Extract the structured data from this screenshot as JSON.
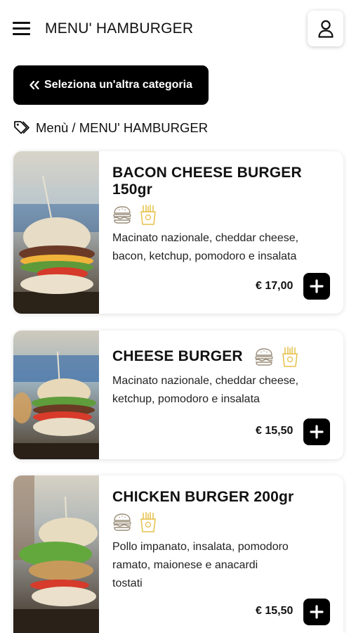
{
  "header": {
    "title": "MENU' HAMBURGER",
    "menu_icon": "hamburger-menu-icon",
    "user_icon": "user-icon"
  },
  "category_button": {
    "icon": "double-chevron-left-icon",
    "label": "Seleziona un'altra categoria"
  },
  "breadcrumb": {
    "icon": "tags-icon",
    "text": "Menù / MENU' HAMBURGER"
  },
  "colors": {
    "accent_gold": "#e6c04a",
    "icon_brown": "#9a8d7a",
    "button_black": "#000000"
  },
  "products": [
    {
      "name_line1": "BACON CHEESE BURGER",
      "name_line2": "150gr",
      "icons": [
        "burger-icon",
        "fries-icon"
      ],
      "desc_lines": [
        "Macinato nazionale, cheddar cheese,",
        "bacon, ketchup, pomodoro e insalata"
      ],
      "price": "€ 17,00"
    },
    {
      "name_line1": "CHEESE BURGER",
      "icons": [
        "burger-icon",
        "fries-icon"
      ],
      "desc_lines": [
        "Macinato nazionale, cheddar cheese,",
        "ketchup, pomodoro e insalata"
      ],
      "price": "€ 15,50"
    },
    {
      "name_line1": "CHICKEN BURGER 200gr",
      "icons": [
        "burger-icon",
        "fries-icon"
      ],
      "desc_lines": [
        "Pollo impanato, insalata, pomodoro",
        "ramato, maionese e anacardi",
        "tostati"
      ],
      "price": "€ 15,50"
    }
  ]
}
